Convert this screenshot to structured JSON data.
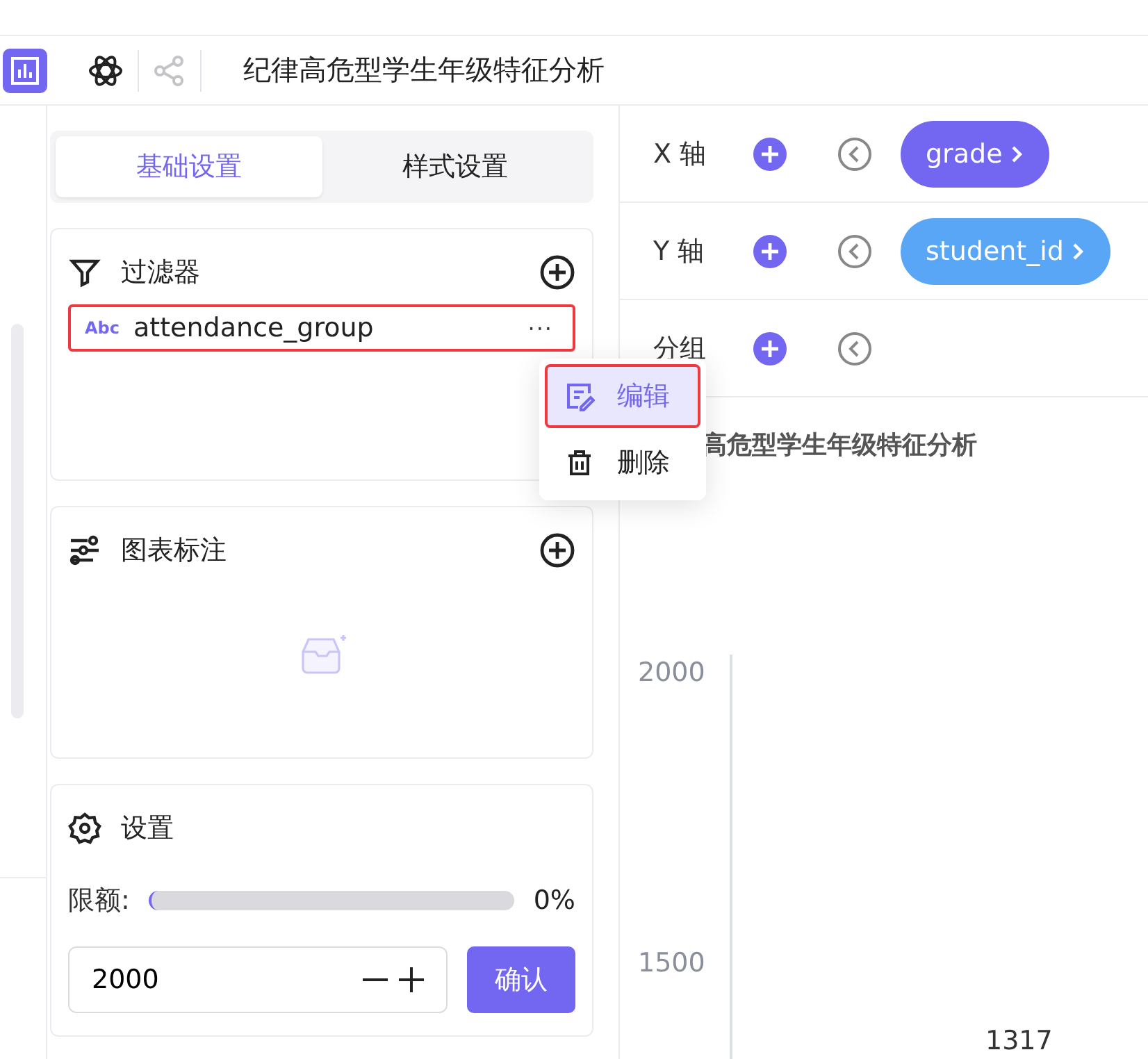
{
  "toolbar": {
    "title": "纪律高危型学生年级特征分析",
    "share_disabled": true
  },
  "settings_tabs": [
    {
      "label": "基础设置",
      "selected": true
    },
    {
      "label": "样式设置",
      "selected": false
    }
  ],
  "filter": {
    "title": "过滤器",
    "items": [
      {
        "type_badge": "Abc",
        "name": "attendance_group",
        "more": "···",
        "highlighted": true
      }
    ]
  },
  "context_menu": [
    {
      "label": "编辑",
      "kind": "edit",
      "selected": true
    },
    {
      "label": "删除",
      "kind": "delete",
      "selected": false
    }
  ],
  "annotations": {
    "title": "图表标注"
  },
  "limit_settings": {
    "title": "设置",
    "label": "限额:",
    "level": 0,
    "reading": "0%",
    "value": "2000",
    "confirm": "确认"
  },
  "axes": [
    {
      "label": "X 轴",
      "field": "grade",
      "kind": "dimension"
    },
    {
      "label": "Y 轴",
      "field": "student_id",
      "kind": "measure"
    },
    {
      "label": "分组"
    }
  ],
  "chart": {
    "title": "高危型学生年级特征分析",
    "y_tick_labels": [
      "2000",
      "1500"
    ],
    "data_label": "1317"
  }
}
